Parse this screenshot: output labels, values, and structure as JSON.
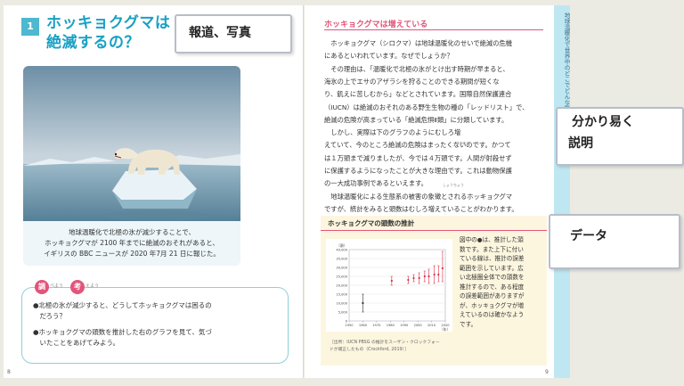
{
  "left_page": {
    "chapter_number": "1",
    "heading_line1": "ホッキョクグマは",
    "heading_line2": "絶滅するの？",
    "caption_lines": [
      "地球温暖化で北極の氷が減少することで、",
      "ホッキョクグマが 2100 年までに絶滅のおそれがあると、",
      "イギリスの BBC ニュースが 2020 年7月 21 日に報じた。"
    ],
    "quiz": {
      "badge1": "調",
      "badge1_suffix": "べよう",
      "badge2": "考",
      "badge2_suffix": "えよう",
      "items": [
        "●北極の氷が減少すると、どうしてホッキョクグマは困るの",
        "　だろう？",
        "●ホッキョクグマの頭数を推計した右のグラフを見て、気づ",
        "　いたことをあげてみよう。"
      ]
    },
    "page_number": "8"
  },
  "right_page": {
    "section_title": "ホッキョクグマは増えている",
    "body_lines": [
      "　ホッキョクグマ（シロクマ）は地球温暖化のせいで絶滅の危機",
      "にあるといわれています。なぜでしょうか？",
      "　その理由は、「温暖化で北極の氷がとけ出す時期が早まると、",
      "海氷の上でエサのアザラシを狩ることのできる期間が短くな",
      "り、飢えに苦しむから」などとされています。国際自然保護連合",
      "（IUCN）は絶滅のおそれのある野生生物の種の「レッドリスト」で、",
      "絶滅の危険が高まっている「絶滅危惧Ⅱ類」に分類しています。",
      "　しかし、実際は下のグラフのようにむしろ増",
      "えていて、今のところ絶滅の危険はまったくないのです。かつて",
      "は１万頭まで減りましたが、今では４万頭です。人間が射殺せず",
      "に保護するようになったことが大きな理由です。これは動物保護",
      "の一大成功事例であるといえます。",
      "　地球温暖化による生態系の被害の象徴とされるホッキョクグマ",
      "ですが、統計をみると頭数はむしろ増えていることがわかります。"
    ],
    "ruby_shocho": "しょうちょう",
    "ruby_zetsumetsu": "ぜつめつ",
    "page_number": "9"
  },
  "chart_section": {
    "title": "ホッキョクグマの頭数の推計",
    "note_lines": [
      "図中の●は、推計した頭",
      "数です。また上下に付い",
      "ている線は、推計の誤差",
      "範囲を示しています。広",
      "い北極圏全体での頭数を",
      "推計するので、ある程度",
      "の誤差範囲がありますが",
      "が、ホッキョクグマが増",
      "えているのは確かなよう",
      "です。"
    ],
    "source_lines": [
      "［出所：IUCN PBSG の推計をスーザン・クロックフォー",
      "ドが補正したもの（Crockford, 2019）］"
    ]
  },
  "chart_data": {
    "type": "scatter",
    "title": "",
    "ylabel": "（頭）",
    "xlabel": "（年）",
    "xlim": [
      1950,
      2020
    ],
    "ylim": [
      0,
      40000
    ],
    "xticks": [
      "1950",
      "1960",
      "1970",
      "1980",
      "1990",
      "2000",
      "2010",
      "2020"
    ],
    "yticks": [
      "0",
      "5,000",
      "10,000",
      "15,000",
      "20,000",
      "25,000",
      "30,000",
      "35,000",
      "40,000"
    ],
    "points": [
      {
        "x": 1960,
        "y": 10000,
        "low": 5000,
        "high": 15000,
        "color": "#333333"
      },
      {
        "x": 1981,
        "y": 22500,
        "low": 20000,
        "high": 25000,
        "color": "#d9304a"
      },
      {
        "x": 1993,
        "y": 23000,
        "low": 21000,
        "high": 25000,
        "color": "#d9304a"
      },
      {
        "x": 1997,
        "y": 24000,
        "low": 22000,
        "high": 26000,
        "color": "#d9304a"
      },
      {
        "x": 2001,
        "y": 24000,
        "low": 21000,
        "high": 27000,
        "color": "#d9304a"
      },
      {
        "x": 2005,
        "y": 25000,
        "low": 22000,
        "high": 28000,
        "color": "#d9304a"
      },
      {
        "x": 2008,
        "y": 25000,
        "low": 21000,
        "high": 29000,
        "color": "#d9304a"
      },
      {
        "x": 2012,
        "y": 26000,
        "low": 21000,
        "high": 31000,
        "color": "#d9304a"
      },
      {
        "x": 2015,
        "y": 26000,
        "low": 22000,
        "high": 31000,
        "color": "#d9304a"
      },
      {
        "x": 2018,
        "y": 29500,
        "low": 22000,
        "high": 39000,
        "color": "#d9304a"
      }
    ]
  },
  "side_strip_text": "地球温暖化で世界中のどこでどんな影響があるの？",
  "callouts": {
    "news_photo": "報道、写真",
    "explanation_line1": "分かり易く",
    "explanation_line2": "説明",
    "data": "データ"
  },
  "colors": {
    "accent_cyan": "#19a0c4",
    "accent_pink": "#e2547a",
    "chart_bg": "#fdf6df"
  }
}
